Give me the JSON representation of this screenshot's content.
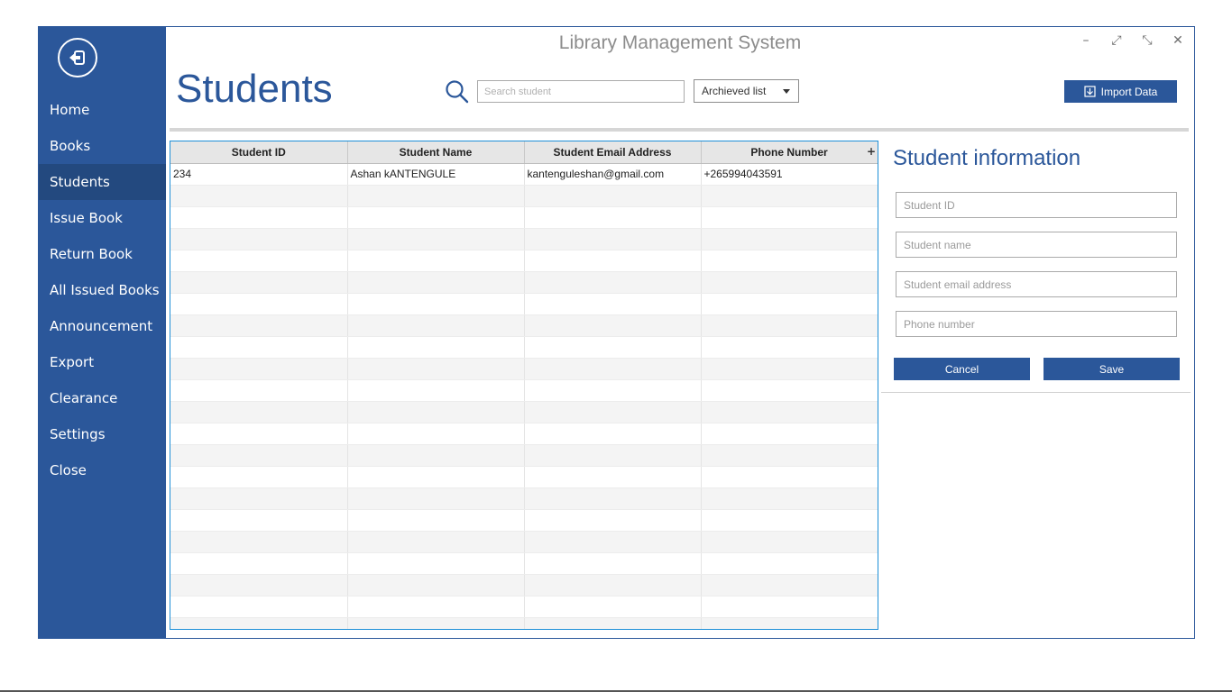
{
  "window": {
    "title": "Library Management System",
    "controls": {
      "minimize": "–",
      "expand": "⤢",
      "restore": "⤡",
      "close": "✕"
    }
  },
  "sidebar": {
    "back_icon": "back-arrow-icon",
    "items": [
      {
        "label": "Home"
      },
      {
        "label": "Books"
      },
      {
        "label": "Students"
      },
      {
        "label": "Issue Book"
      },
      {
        "label": "Return Book"
      },
      {
        "label": "All Issued Books"
      },
      {
        "label": "Announcement"
      },
      {
        "label": "Export"
      },
      {
        "label": "Clearance"
      },
      {
        "label": "Settings"
      },
      {
        "label": "Close"
      }
    ],
    "active": "Students"
  },
  "page": {
    "title": "Students"
  },
  "toolbar": {
    "search_icon": "search-icon",
    "search_placeholder": "Search student",
    "filter_value": "Archieved list",
    "import_label": "Import Data",
    "import_icon": "download-icon"
  },
  "table": {
    "columns": [
      "Student ID",
      "Student Name",
      "Student Email Address",
      "Phone  Number"
    ],
    "add_column_glyph": "+",
    "rows": [
      [
        "234",
        "Ashan kANTENGULE",
        "kantenguleshan@gmail.com",
        "+265994043591"
      ]
    ]
  },
  "form": {
    "title": "Student information",
    "fields": [
      {
        "placeholder": "Student ID"
      },
      {
        "placeholder": "Student name"
      },
      {
        "placeholder": "Student email address"
      },
      {
        "placeholder": "Phone number"
      }
    ],
    "cancel_label": "Cancel",
    "save_label": "Save"
  },
  "colors": {
    "primary": "#2b579a",
    "sidebar_active": "#23497f",
    "table_border": "#1e90d8"
  }
}
